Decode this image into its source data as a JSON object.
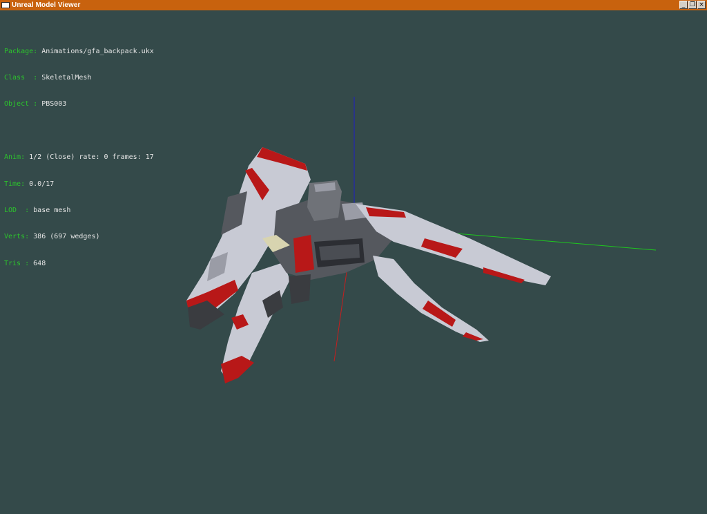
{
  "window": {
    "title": "Unreal Model Viewer",
    "controls": {
      "minimize": "_",
      "restore": "❐",
      "close": "×"
    }
  },
  "info": {
    "package": {
      "label": "Package: ",
      "value": "Animations/gfa_backpack.ukx"
    },
    "class": {
      "label": "Class  : ",
      "value": "SkeletalMesh"
    },
    "object": {
      "label": "Object : ",
      "value": "PBS003"
    },
    "anim": {
      "label": "Anim: ",
      "value": "1/2 (Close) rate: 0 frames: 17"
    },
    "time": {
      "label": "Time: ",
      "value": "0.0/17"
    },
    "lod": {
      "label": "LOD  : ",
      "value": "base mesh"
    },
    "verts": {
      "label": "Verts: ",
      "value": "386 (697 wedges)"
    },
    "tris": {
      "label": "Tris : ",
      "value": "648"
    }
  },
  "colors": {
    "titlebar": "#c8620e",
    "viewport_bg": "#344a4a",
    "label": "#2cc42c",
    "value": "#e6e6e6",
    "axis_x": "#c81e1e",
    "axis_y": "#1ec81e",
    "axis_z": "#1e1ec8",
    "mesh_white": "#c8cad4",
    "mesh_red": "#b81818",
    "mesh_dark": "#3a3c40"
  }
}
